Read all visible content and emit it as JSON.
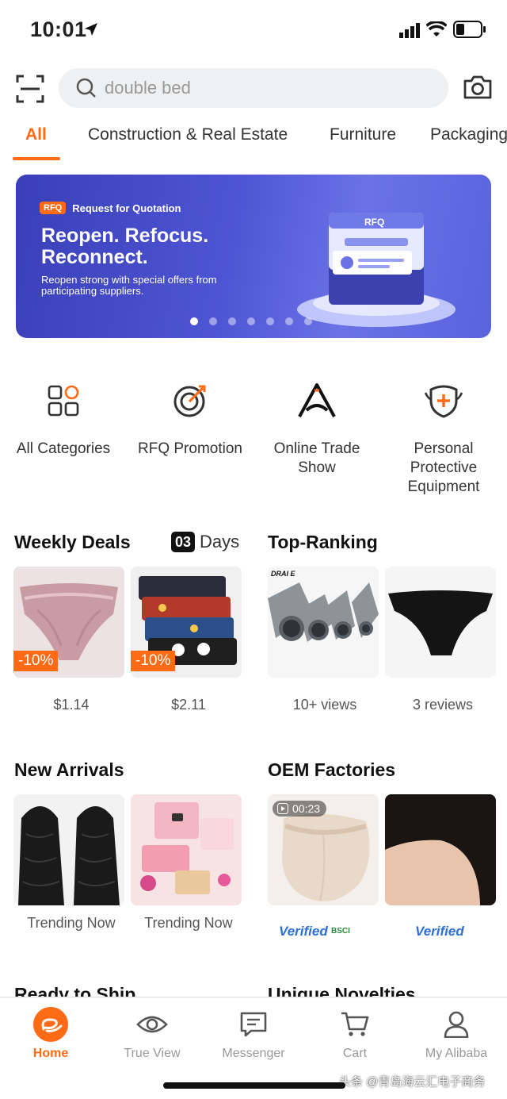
{
  "status_bar": {
    "time": "10:01"
  },
  "search": {
    "placeholder": "double bed"
  },
  "tabs": [
    {
      "label": "All"
    },
    {
      "label": "Construction & Real Estate"
    },
    {
      "label": "Furniture"
    },
    {
      "label": "Packaging"
    }
  ],
  "banner": {
    "logo": "RFQ",
    "tag": "Request for Quotation",
    "headline": "Reopen. Refocus. Reconnect.",
    "subline": "Reopen strong with special offers from participating suppliers.",
    "illus_text": "RFQ",
    "active_slide": 1,
    "slide_count": 7
  },
  "quick_links": [
    {
      "label": "All Categories",
      "icon": "categories-grid-icon"
    },
    {
      "label": "RFQ Promotion",
      "icon": "target-icon"
    },
    {
      "label": "Online Trade Show",
      "icon": "trade-show-a-icon"
    },
    {
      "label": "Personal Protective Equipment",
      "icon": "shield-plus-icon"
    }
  ],
  "weekly_deals": {
    "title": "Weekly Deals",
    "days_num": "03",
    "days_label": "Days",
    "items": [
      {
        "discount": "-10%",
        "price": "$1.14"
      },
      {
        "discount": "-10%",
        "price": "$2.11"
      }
    ]
  },
  "top_ranking": {
    "title": "Top-Ranking",
    "items": [
      {
        "caption": "10+ views",
        "brand": "DRAI E"
      },
      {
        "caption": "3 reviews"
      }
    ]
  },
  "new_arrivals": {
    "title": "New Arrivals",
    "items": [
      {
        "caption": "Trending Now"
      },
      {
        "caption": "Trending Now"
      }
    ]
  },
  "oem_factories": {
    "title": "OEM Factories",
    "video_time": "00:23",
    "items": [
      {
        "badge": "Verified",
        "extra": "BSCI"
      },
      {
        "badge": "Verified"
      }
    ]
  },
  "cut_titles": {
    "left": "Ready to Ship",
    "right": "Unique Novelties"
  },
  "bottom_nav": [
    {
      "label": "Home",
      "icon": "home-icon"
    },
    {
      "label": "True View",
      "icon": "eye-icon"
    },
    {
      "label": "Messenger",
      "icon": "chat-icon"
    },
    {
      "label": "Cart",
      "icon": "cart-icon"
    },
    {
      "label": "My Alibaba",
      "icon": "user-icon"
    }
  ],
  "watermark": "头条 @青岛海云汇电子商务",
  "colors": {
    "accent": "#ff6a14",
    "banner": "#4e55d4",
    "verified": "#2d6fd8"
  }
}
